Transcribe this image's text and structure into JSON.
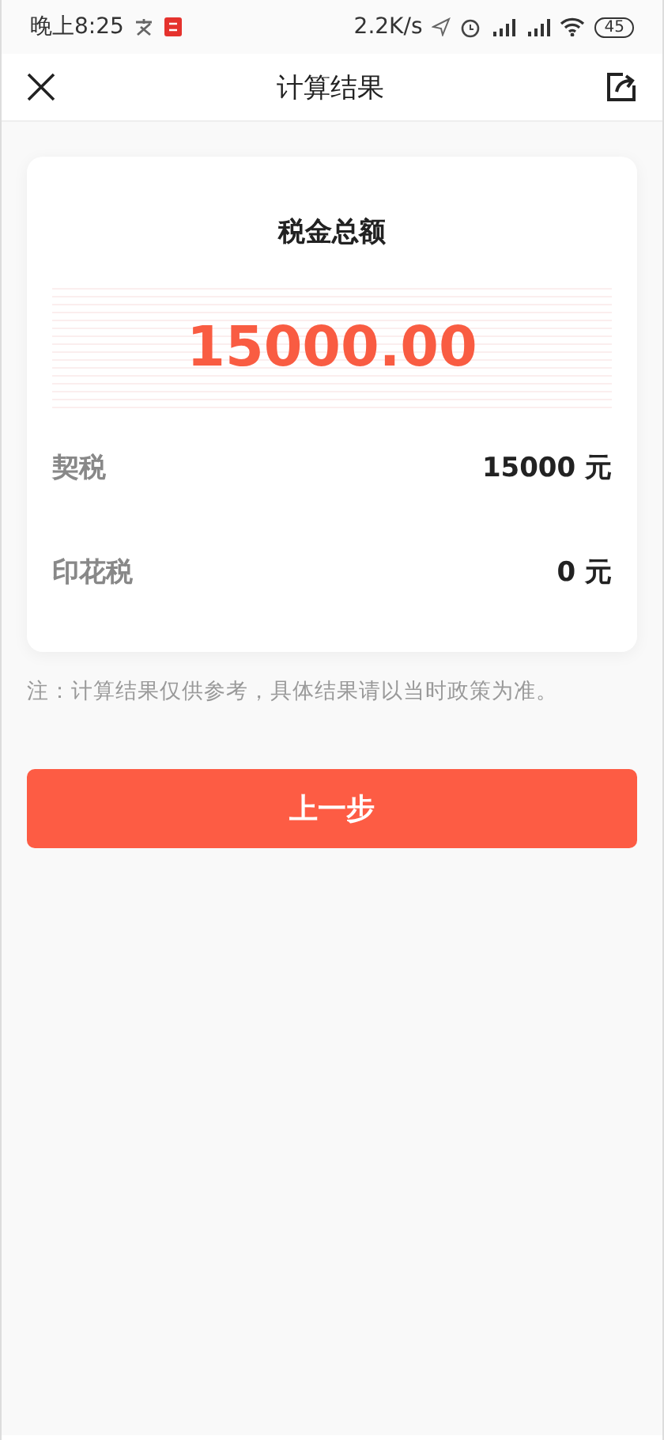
{
  "status_bar": {
    "time": "晚上8:25",
    "speed": "2.2K/s",
    "battery": "45"
  },
  "nav": {
    "title": "计算结果"
  },
  "result": {
    "title": "税金总额",
    "total": "15000.00",
    "items": [
      {
        "label": "契税",
        "value": "15000 元"
      },
      {
        "label": "印花税",
        "value": "0 元"
      }
    ]
  },
  "note": "注：计算结果仅供参考，具体结果请以当时政策为准。",
  "button": "上一步"
}
